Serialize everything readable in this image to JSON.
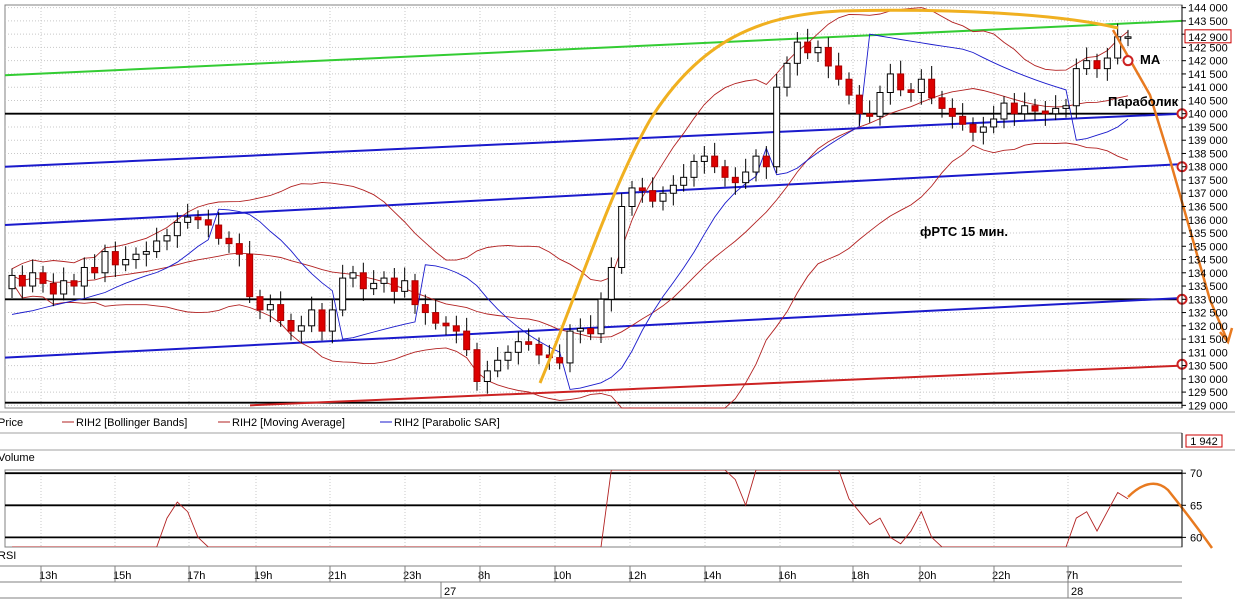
{
  "chart_data": [
    {
      "type": "candlestick",
      "instrument": "RIH2",
      "annotation_title": "фРТС  15 мин.",
      "annotation_ma": "МА",
      "annotation_parabolic": "Параболик",
      "last_price_label": "142 900",
      "last_price": 142900,
      "ylim": [
        128900,
        144100
      ],
      "y_ticks": [
        129000,
        129500,
        130000,
        130500,
        131000,
        131500,
        132000,
        132500,
        133000,
        133500,
        134000,
        134500,
        135000,
        135500,
        136000,
        136500,
        137000,
        137500,
        138000,
        138500,
        139000,
        139500,
        140000,
        140500,
        141000,
        141500,
        142000,
        142500,
        143000,
        143500,
        144000
      ],
      "y_tick_labels": [
        "129 000",
        "129 500",
        "130 000",
        "130 500",
        "131 000",
        "131 500",
        "132 000",
        "132 500",
        "133 000",
        "133 500",
        "134 000",
        "134 500",
        "135 000",
        "135 500",
        "136 000",
        "136 500",
        "137 000",
        "137 500",
        "138 000",
        "138 500",
        "139 000",
        "139 500",
        "140 000",
        "140 500",
        "141 000",
        "141 500",
        "142 000",
        "142 500",
        "143 000",
        "143 500",
        "144 000"
      ],
      "legend": [
        "Price",
        "RIH2 [Bollinger Bands]",
        "RIH2 [Moving Average]",
        "RIH2 [Parabolic SAR]"
      ],
      "horizontal_levels": [
        140000,
        133000,
        129100
      ],
      "candle_closes": [
        133900,
        133500,
        134000,
        133600,
        133200,
        133700,
        133500,
        134200,
        134000,
        134800,
        134300,
        134500,
        134700,
        134800,
        135200,
        135400,
        135900,
        136100,
        136000,
        135800,
        135300,
        135100,
        134700,
        133100,
        132600,
        132800,
        132200,
        131800,
        132000,
        132600,
        131800,
        132600,
        133800,
        134000,
        133400,
        133600,
        133800,
        133300,
        133700,
        132800,
        132500,
        132100,
        132000,
        131800,
        131100,
        129900,
        130300,
        130700,
        131000,
        131400,
        131300,
        130900,
        130800,
        130600,
        131800,
        131900,
        131700,
        133000,
        134200,
        136500,
        137200,
        137100,
        136700,
        137000,
        137300,
        137600,
        138200,
        138400,
        138000,
        137600,
        137400,
        137800,
        138400,
        138000,
        141000,
        141900,
        142700,
        142300,
        142500,
        141800,
        141300,
        140700,
        140000,
        139900,
        140800,
        141500,
        140900,
        140800,
        141300,
        140600,
        140200,
        139900,
        139600,
        139300,
        139500,
        139800,
        140400,
        140000,
        140300,
        140100,
        140000,
        140200,
        140300,
        141700,
        142000,
        141700,
        142100,
        142900,
        142900
      ],
      "rsi": {
        "label": "RSI",
        "ylim": [
          58.5,
          70.5
        ],
        "ticks": [
          60,
          65,
          70
        ],
        "levels": [
          70,
          65,
          60
        ],
        "values": [
          58,
          58,
          58,
          58,
          58,
          58,
          58,
          58,
          58,
          58,
          58,
          58,
          58,
          58,
          58,
          63,
          65.5,
          64,
          60,
          58,
          58,
          58,
          58,
          58,
          58,
          58,
          58,
          58,
          58,
          58,
          58,
          58,
          58,
          58,
          58,
          58,
          58,
          58,
          58,
          58,
          58,
          58,
          58,
          58,
          58,
          58,
          58,
          58,
          58,
          58,
          58,
          58,
          58,
          58,
          58,
          58,
          58,
          58,
          75,
          75,
          75,
          75,
          75,
          75,
          75,
          75,
          75,
          75,
          75,
          72,
          69,
          65,
          75,
          73,
          75,
          75,
          75,
          75,
          75,
          75,
          72,
          66,
          64,
          62,
          63,
          60,
          59,
          61,
          64,
          60,
          58,
          58,
          58,
          58,
          58,
          58,
          58,
          58,
          58,
          58,
          58,
          58,
          58,
          63,
          64,
          61,
          64,
          67,
          66
        ]
      },
      "volume": {
        "label": "Volume",
        "last_value_label": "1 942"
      },
      "x_tick_labels": [
        "13h",
        "15h",
        "17h",
        "19h",
        "21h",
        "23h",
        "8h",
        "10h",
        "12h",
        "14h",
        "16h",
        "18h",
        "20h",
        "22h",
        "7h"
      ],
      "date_labels": [
        "27",
        "28"
      ]
    }
  ]
}
